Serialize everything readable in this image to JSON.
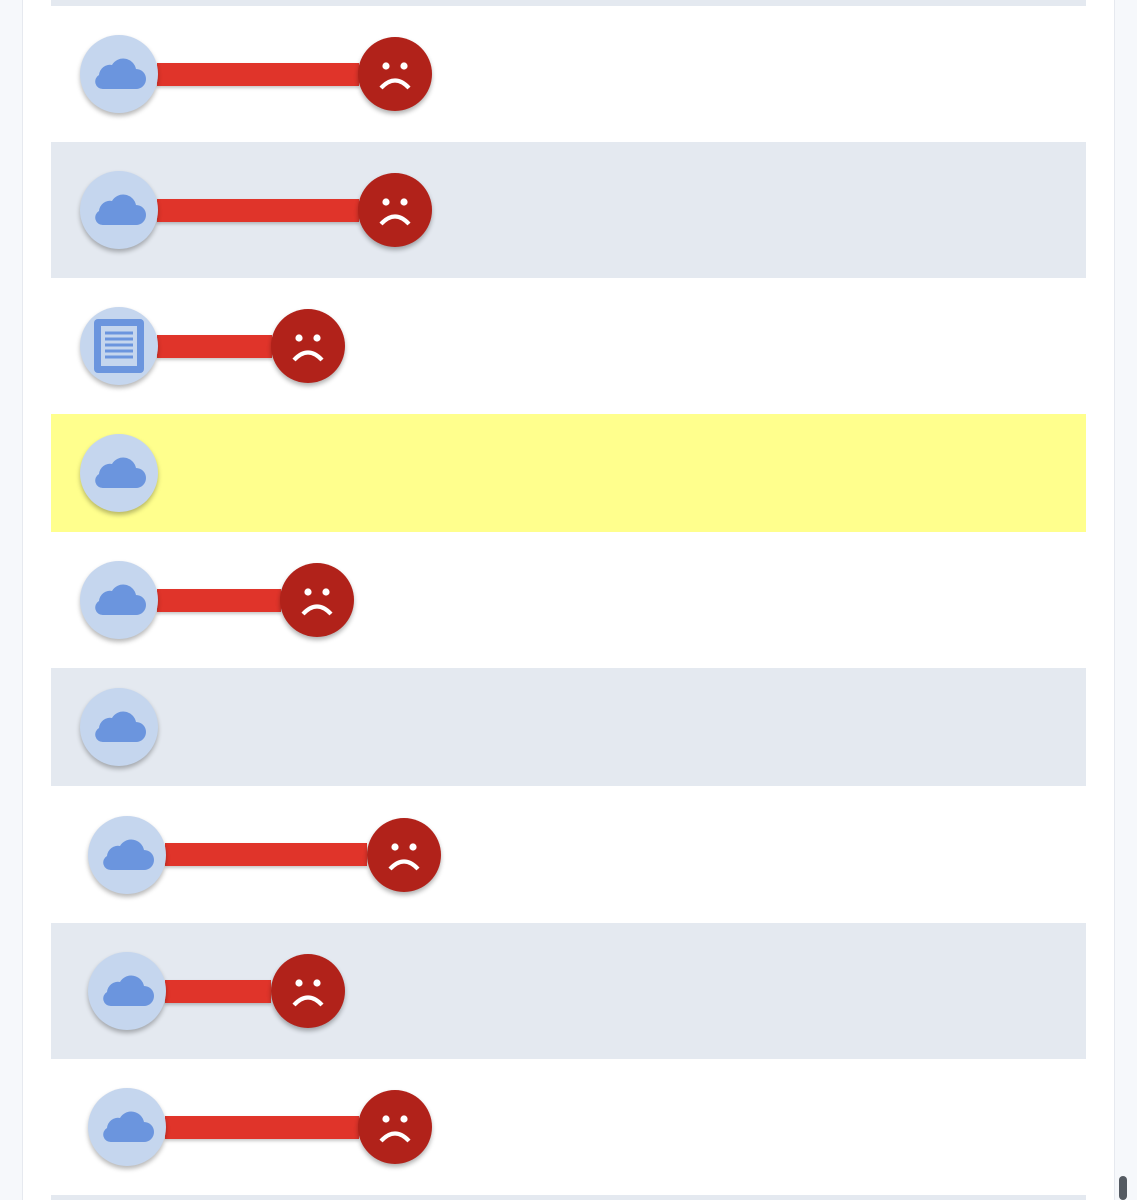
{
  "theme": {
    "row_white": "#ffffff",
    "row_gray": "#e4e9f0",
    "row_highlight": "#ffff8d",
    "source_fill": "#c5d6ee",
    "icon_blue": "#6b95de",
    "connector_red": "#e0342a",
    "sad_red": "#b1221a"
  },
  "rows": [
    {
      "style": "white",
      "source_icon": "cloud-icon",
      "status_icon": "sad-face-icon"
    },
    {
      "style": "gray",
      "source_icon": "cloud-icon",
      "status_icon": "sad-face-icon"
    },
    {
      "style": "white",
      "source_icon": "document-icon",
      "status_icon": "sad-face-icon"
    },
    {
      "style": "highlight",
      "source_icon": "cloud-icon",
      "status_icon": null
    },
    {
      "style": "white",
      "source_icon": "cloud-icon",
      "status_icon": "sad-face-icon"
    },
    {
      "style": "gray",
      "source_icon": "cloud-icon",
      "status_icon": null
    },
    {
      "style": "white",
      "source_icon": "cloud-icon",
      "status_icon": "sad-face-icon"
    },
    {
      "style": "gray",
      "source_icon": "cloud-icon",
      "status_icon": "sad-face-icon"
    },
    {
      "style": "white",
      "source_icon": "cloud-icon",
      "status_icon": "sad-face-icon"
    }
  ]
}
